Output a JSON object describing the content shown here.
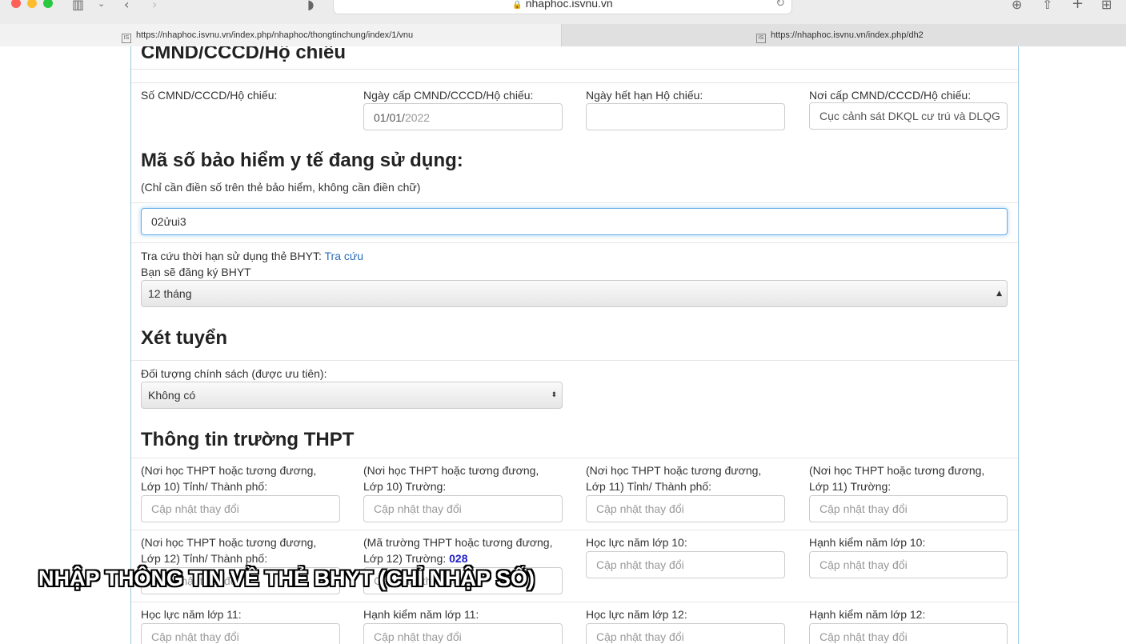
{
  "browser": {
    "address": "nhaphoc.isvnu.vn",
    "tabs": [
      {
        "label": "https://nhaphoc.isvnu.vn/index.php/nhaphoc/thongtinchung/index/1/vnu",
        "favicon": "IS"
      },
      {
        "label": "https://nhaphoc.isvnu.vn/index.php/dh2",
        "favicon": "IS"
      }
    ]
  },
  "id_section": {
    "title": "CMND/CCCD/Hộ chiếu",
    "fields": [
      {
        "label": "Số CMND/CCCD/Hộ chiếu:",
        "value": ""
      },
      {
        "label": "Ngày cấp CMND/CCCD/Hộ chiếu:",
        "value_day": "01/01/",
        "value_year": "2022"
      },
      {
        "label": "Ngày hết hạn Hộ chiếu:",
        "value": ""
      },
      {
        "label": "Nơi cấp CMND/CCCD/Hộ chiếu:",
        "value": "Cục cảnh sát DKQL cư trú và DLQG"
      }
    ]
  },
  "insurance": {
    "title": "Mã số bảo hiểm y tế đang sử dụng:",
    "note": "(Chỉ cần điền số trên thẻ bảo hiểm, không cần điền chữ)",
    "value": "02ửui3",
    "lookup_label": "Tra cứu thời hạn sử dụng thẻ BHYT:",
    "lookup_link": "Tra cứu",
    "register_label": "Bạn sẽ đăng ký BHYT",
    "register_value": "12 tháng"
  },
  "admission": {
    "title": "Xét tuyển",
    "policy_label": "Đối tượng chính sách (được ưu tiên):",
    "policy_value": "Không có"
  },
  "school": {
    "title": "Thông tin trường THPT",
    "placeholder": "Cập nhật thay đổi",
    "row1": [
      {
        "line1": "(Nơi học THPT hoặc tương đương,",
        "line2": "Lớp 10) Tỉnh/ Thành phố:"
      },
      {
        "line1": "(Nơi học THPT hoặc tương đương,",
        "line2": "Lớp 10) Trường:"
      },
      {
        "line1": "(Nơi học THPT hoặc tương đương,",
        "line2": "Lớp 11) Tỉnh/ Thành phố:"
      },
      {
        "line1": "(Nơi học THPT hoặc tương đương,",
        "line2": "Lớp 11) Trường:"
      }
    ],
    "row2": [
      {
        "line1": "(Nơi học THPT hoặc tương đương,",
        "line2": "Lớp 12) Tỉnh/ Thành phố:"
      },
      {
        "line1": "(Mã trường THPT hoặc tương đương,",
        "line2": "Lớp 12) Trường:",
        "code": "028"
      },
      {
        "line1": "Học lực năm lớp 10:"
      },
      {
        "line1": "Hạnh kiểm năm lớp 10:"
      }
    ],
    "row3": [
      {
        "line1": "Học lực năm lớp 11:"
      },
      {
        "line1": "Hạnh kiểm năm lớp 11:"
      },
      {
        "line1": "Học lực năm lớp 12:"
      },
      {
        "line1": "Hạnh kiểm năm lớp 12:"
      }
    ]
  },
  "caption": "NHẬP THÔNG TIN VỀ THẺ BHYT (CHỈ NHẬP SỐ)"
}
